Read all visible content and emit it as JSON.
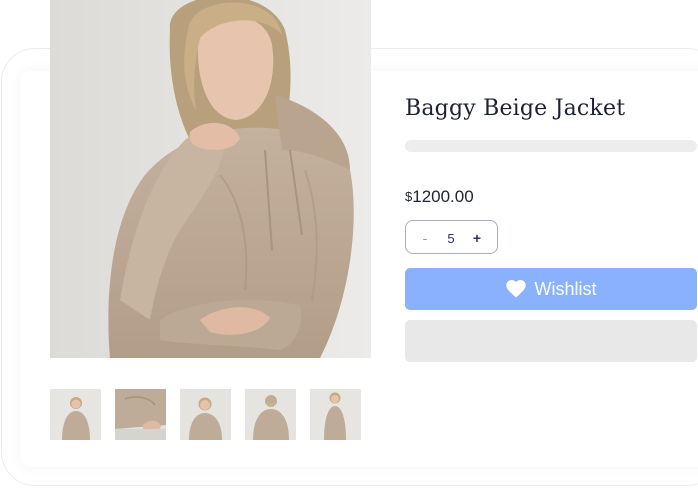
{
  "product": {
    "title": "Baggy Beige Jacket",
    "currency_symbol": "$",
    "price": "1200.00",
    "hero_image_alt": "Woman in beige hoodie",
    "thumbnail_count": 5
  },
  "quantity": {
    "decrement_label": "-",
    "value": "5",
    "increment_label": "+"
  },
  "actions": {
    "wishlist_label": "Wishlist",
    "wishlist_icon": "heart-icon"
  },
  "colors": {
    "wishlist_button": "#89b1fd",
    "title_text": "#1e2130",
    "skeleton": "#ececec",
    "garment_beige": "#bfac98"
  }
}
